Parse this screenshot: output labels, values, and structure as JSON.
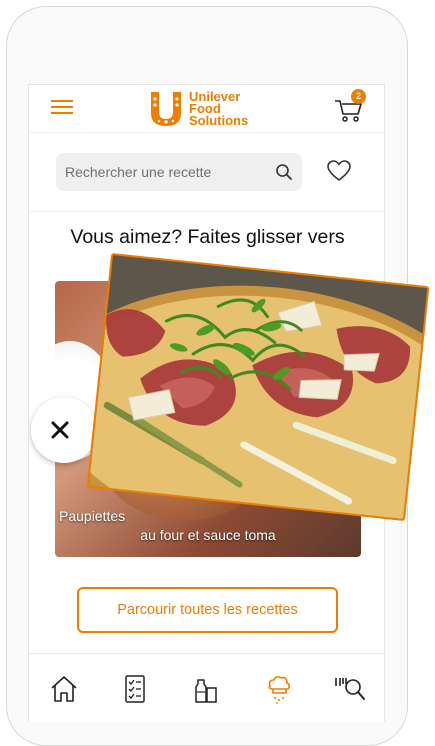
{
  "header": {
    "logo_line1": "Unilever",
    "logo_line2": "Food",
    "logo_line3": "Solutions",
    "cart_count": "2"
  },
  "search": {
    "placeholder": "Rechercher une recette"
  },
  "swipe": {
    "title": "Vous aimez? Faites glisser vers",
    "back_card_caption_line1": "Paupiettes",
    "back_card_caption_line2": "au four et sauce toma"
  },
  "cta": {
    "label": "Parcourir toutes les recettes"
  },
  "colors": {
    "accent": "#ee7d00"
  },
  "bottom_nav": [
    {
      "icon": "home-icon"
    },
    {
      "icon": "checklist-icon"
    },
    {
      "icon": "products-icon"
    },
    {
      "icon": "chef-icon",
      "active": true
    },
    {
      "icon": "search-barcode-icon"
    }
  ]
}
